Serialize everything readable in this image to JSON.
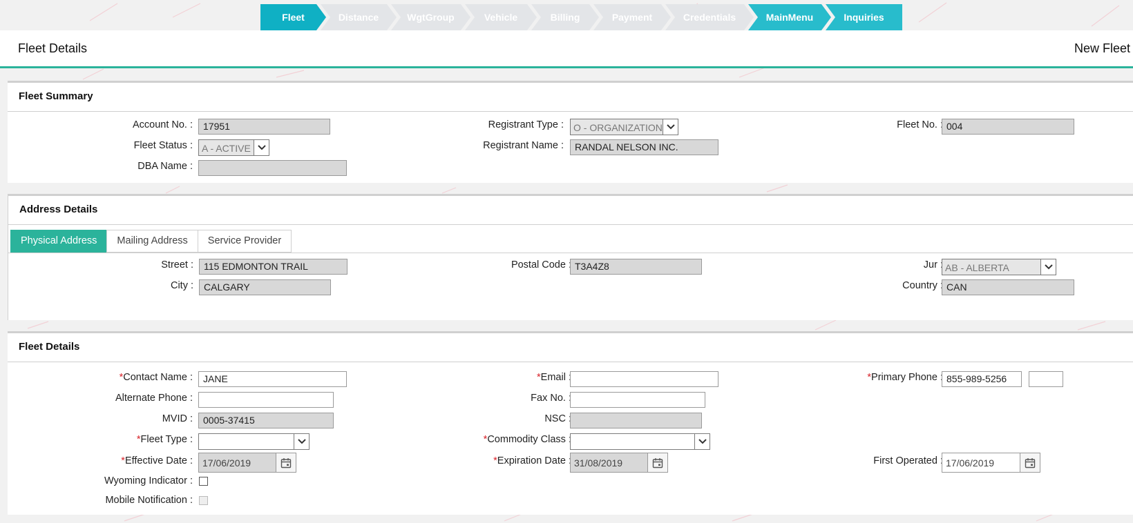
{
  "wizard": {
    "steps": [
      "Fleet",
      "Distance",
      "WgtGroup",
      "Vehicle",
      "Billing",
      "Payment",
      "Credentials",
      "MainMenu",
      "Inquiries"
    ]
  },
  "header": {
    "title": "Fleet Details",
    "right_title": "New Fleet"
  },
  "fleet_summary": {
    "title": "Fleet Summary",
    "account_no_label": "Account No. :",
    "account_no": "17951",
    "registrant_type_label": "Registrant Type :",
    "registrant_type": "O - ORGANIZATION",
    "fleet_no_label": "Fleet No. :",
    "fleet_no": "004",
    "fleet_status_label": "Fleet Status :",
    "fleet_status": "A - ACTIVE",
    "registrant_name_label": "Registrant Name :",
    "registrant_name": "RANDAL NELSON INC.",
    "dba_name_label": "DBA Name :",
    "dba_name": ""
  },
  "address_details": {
    "title": "Address Details",
    "tabs": [
      "Physical Address",
      "Mailing Address",
      "Service Provider"
    ],
    "street_label": "Street :",
    "street": "115 EDMONTON TRAIL",
    "postal_code_label": "Postal Code :",
    "postal_code": "T3A4Z8",
    "jur_label": "Jur :",
    "jur": "AB - ALBERTA",
    "city_label": "City :",
    "city": "CALGARY",
    "country_label": "Country :",
    "country": "CAN"
  },
  "fleet_details": {
    "title": "Fleet Details",
    "required_mark": "*",
    "contact_name_label": "Contact Name :",
    "contact_name": "JANE",
    "email_label": "Email :",
    "email": "",
    "primary_phone_label": "Primary Phone :",
    "primary_phone": "855-989-5256",
    "primary_phone_ext": "",
    "alternate_phone_label": "Alternate Phone :",
    "alternate_phone": "",
    "fax_no_label": "Fax No. :",
    "fax_no": "",
    "mvid_label": "MVID :",
    "mvid": "0005-37415",
    "nsc_label": "NSC :",
    "nsc": "",
    "fleet_type_label": "Fleet Type :",
    "fleet_type": "",
    "commodity_class_label": "Commodity Class :",
    "commodity_class": "",
    "effective_date_label": "Effective Date :",
    "effective_date": "17/06/2019",
    "expiration_date_label": "Expiration Date :",
    "expiration_date": "31/08/2019",
    "first_operated_label": "First Operated :",
    "first_operated": "17/06/2019",
    "wyoming_indicator_label": "Wyoming Indicator :",
    "mobile_notification_label": "Mobile Notification :"
  },
  "colors": {
    "accent_teal": "#2bb39b",
    "wizard_active": "#0fb0c4",
    "required": "#d8232a"
  }
}
